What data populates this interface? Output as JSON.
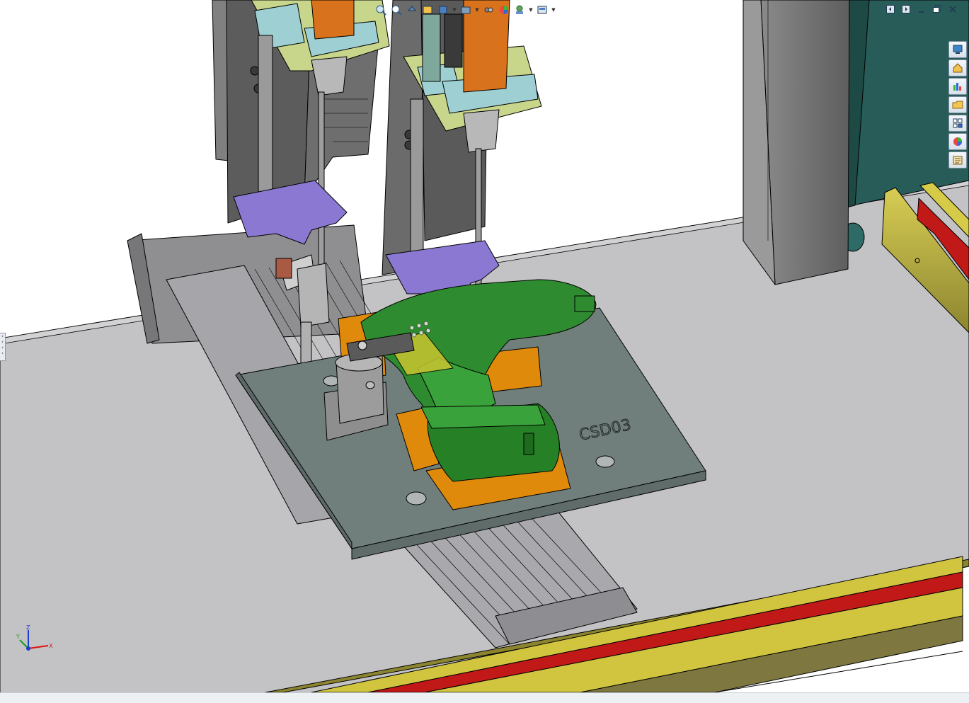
{
  "viewport": {
    "plate_label": "CSD03",
    "colors": {
      "background": "#ffffff",
      "floor": "#c3c3c6",
      "plate": "#707f7c",
      "fixture_orange": "#e08a0c",
      "tool_green": "#2f8b2f",
      "bracket_purple": "#8b78d2",
      "screwdriver_orange": "#d8721c",
      "mount_plate": "#c8d68c",
      "clamp_block": "#9ecfd2",
      "conveyor_rail": "#b8b040",
      "conveyor_belt": "#c11818",
      "column": "#7c7c7c",
      "teal_wall": "#285c58"
    }
  },
  "triad": {
    "x_label": "X",
    "y_label": "Y",
    "z_label": "Z"
  },
  "hud_toolbar": {
    "buttons": [
      "zoom-to-fit-icon",
      "zoom-to-area-icon",
      "previous-view-icon",
      "section-view-icon",
      "view-orientation-icon",
      "display-style-icon",
      "hide-show-items-icon",
      "edit-appearance-icon",
      "apply-scene-icon",
      "view-settings-icon"
    ]
  },
  "window_controls": [
    "previous-window-icon",
    "next-window-icon",
    "minimize-icon",
    "restore-icon",
    "close-icon"
  ],
  "task_pane": {
    "tabs": [
      "solidworks-resources-icon",
      "design-library-icon",
      "toolbox-icon",
      "file-explorer-icon",
      "view-palette-icon",
      "appearances-scenes-icon",
      "custom-properties-icon"
    ]
  }
}
